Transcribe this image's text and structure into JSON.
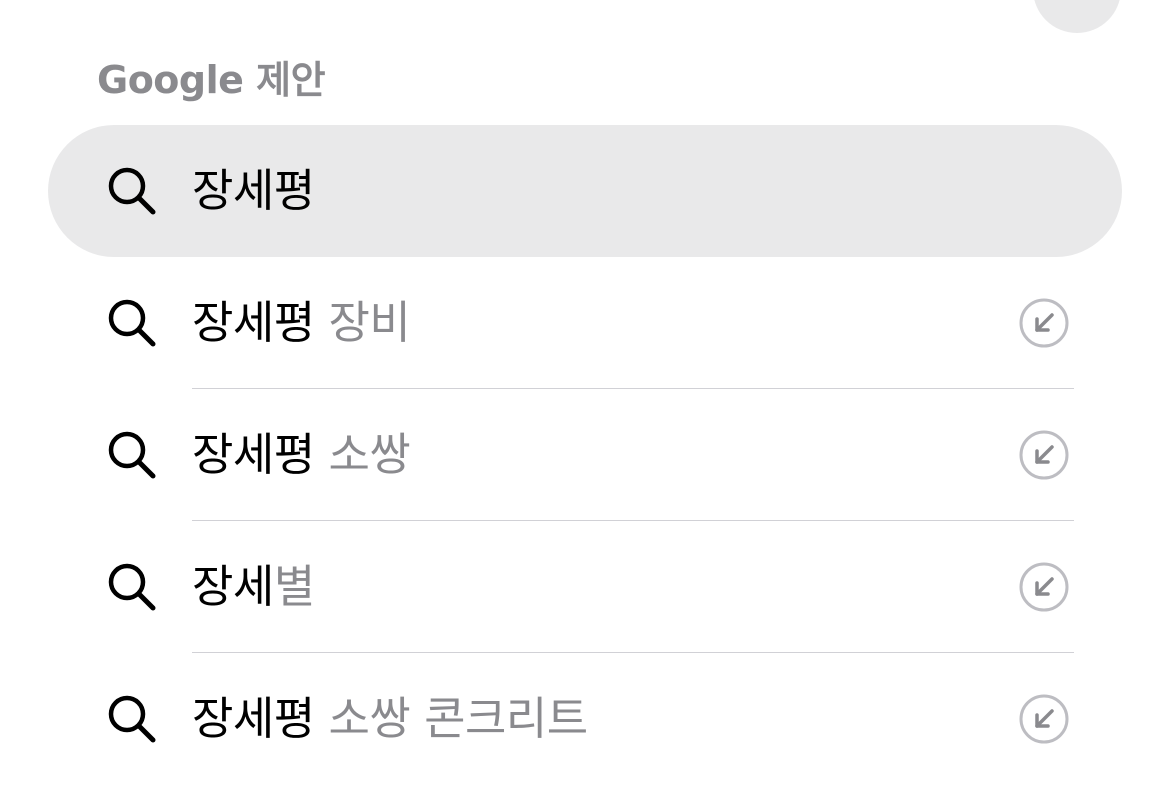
{
  "close_button": {
    "icon": "close-icon"
  },
  "section": {
    "title": "Google 제안"
  },
  "suggestions": [
    {
      "typed": "장세평",
      "completion": "",
      "icon": "search-icon",
      "action_icon": ""
    },
    {
      "typed": "장세평",
      "completion": " 장비",
      "icon": "search-icon",
      "action_icon": "arrow-up-left-icon"
    },
    {
      "typed": "장세평",
      "completion": " 소쌍",
      "icon": "search-icon",
      "action_icon": "arrow-up-left-icon"
    },
    {
      "typed": "장세",
      "completion": "별",
      "icon": "search-icon",
      "action_icon": "arrow-up-left-icon"
    },
    {
      "typed": "장세평",
      "completion": " 소쌍 콘크리트",
      "icon": "search-icon",
      "action_icon": "arrow-up-left-icon"
    }
  ],
  "colors": {
    "text_primary": "#000000",
    "text_muted": "#8a8a8e",
    "highlight_bg": "#e9e9ea",
    "divider": "#d1d1d6",
    "fill_icon": "#bdbdc2"
  }
}
